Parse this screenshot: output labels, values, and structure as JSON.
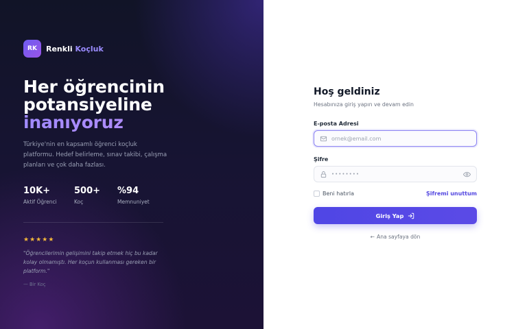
{
  "brand": {
    "logo_text": "RK",
    "name_primary": "Renkli",
    "name_accent": "Koçluk"
  },
  "hero": {
    "headline_line1": "Her öğrencinin",
    "headline_line2": "potansiyeline",
    "headline_accent": "inanıyoruz",
    "description": "Türkiye'nin en kapsamlı öğrenci koçluk platformu. Hedef belirleme, sınav takibi, çalışma planları ve çok daha fazlası."
  },
  "stats": [
    {
      "value": "10K+",
      "label": "Aktif Öğrenci"
    },
    {
      "value": "500+",
      "label": "Koç"
    },
    {
      "value": "%94",
      "label": "Memnuniyet"
    }
  ],
  "testimonial": {
    "stars": 5,
    "quote": "\"Öğrencilerimin gelişimini takip etmek hiç bu kadar kolay olmamıştı. Her koçun kullanması gereken bir platform.\"",
    "author": "— Bir Koç"
  },
  "login": {
    "title": "Hoş geldiniz",
    "subtitle": "Hesabınıza giriş yapın ve devam edin",
    "email_label": "E-posta Adresi",
    "email_placeholder": "ornek@email.com",
    "password_label": "Şifre",
    "password_placeholder": "••••••••",
    "remember_label": "Beni hatırla",
    "forgot_label": "Şifremi unuttum",
    "submit_label": "Giriş Yap",
    "back_label": "Ana sayfaya dön",
    "back_arrow": "←"
  },
  "colors": {
    "accent": "#4f46e5",
    "accent_text": "#5246e0",
    "star": "#f5b93a",
    "left_bg": "#141530"
  },
  "icons": {
    "email": "mail-icon",
    "password": "lock-icon",
    "visibility": "eye-icon",
    "submit": "login-icon",
    "back": "arrow-left-icon",
    "rating": "star-icon"
  }
}
